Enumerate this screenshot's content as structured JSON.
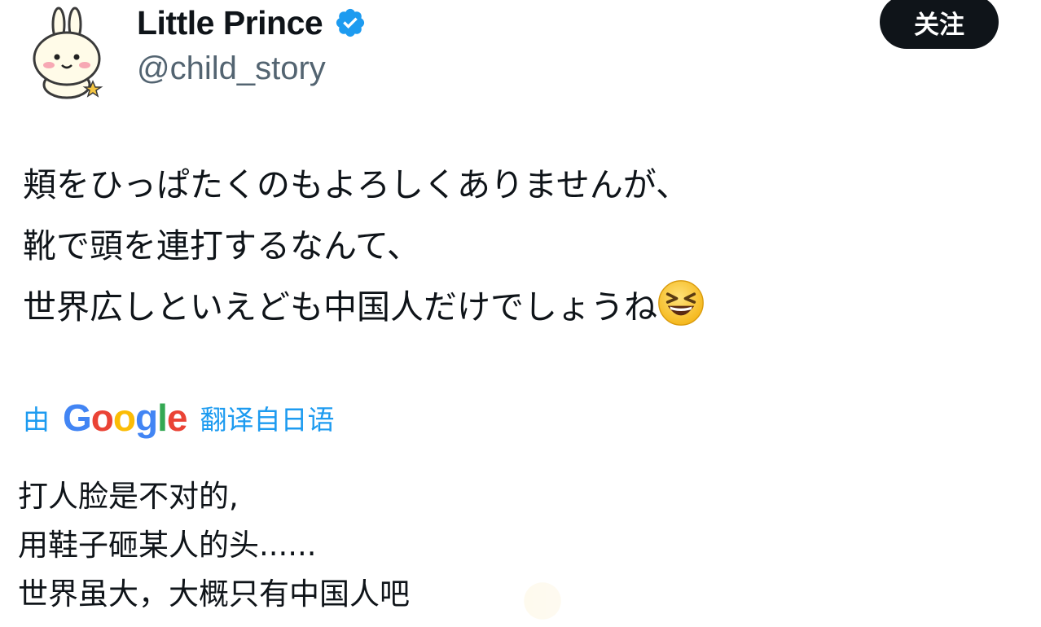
{
  "account": {
    "display_name": "Little Prince",
    "handle": "@child_story",
    "verified": true,
    "avatar_icon": "bunny-avatar-icon",
    "verified_icon": "verified-badge-icon"
  },
  "follow_button": {
    "label": "关注"
  },
  "tweet": {
    "lines": [
      "頬をひっぱたくのもよろしくありませんが、",
      "靴で頭を連打するなんて、",
      "世界広しといえども中国人だけでしょうね"
    ],
    "trailing_emoji": "laughing-squinting-face-emoji"
  },
  "translation": {
    "prefix": "由",
    "provider": "Google",
    "suffix": "翻译自日语",
    "lines": [
      "打人脸是不对的,",
      "用鞋子砸某人的头......",
      "世界虽大，大概只有中国人吧"
    ]
  },
  "colors": {
    "text_primary": "#0f1419",
    "text_secondary": "#536471",
    "link_blue": "#1d9bf0",
    "button_bg": "#0f1419",
    "button_text": "#ffffff",
    "verified_blue": "#1d9bf0",
    "google_blue": "#4285f4",
    "google_red": "#ea4335",
    "google_yellow": "#fbbc05",
    "google_green": "#34a853"
  }
}
